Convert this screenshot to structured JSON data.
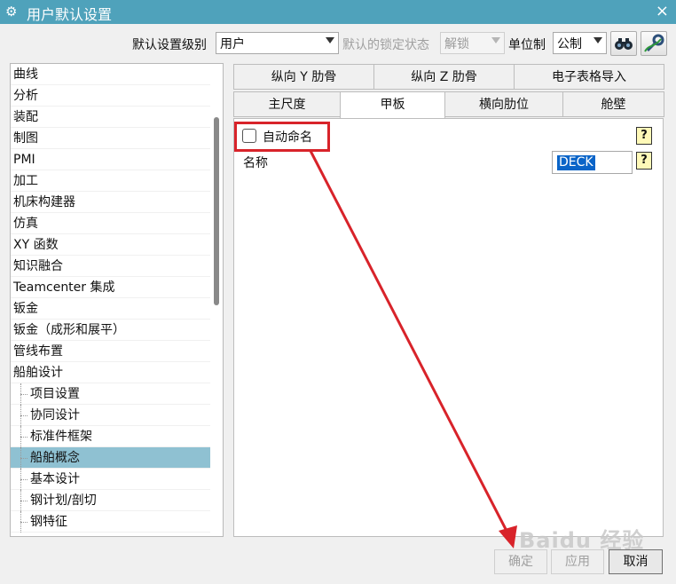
{
  "window": {
    "title": "用户默认设置",
    "close_glyph": "×"
  },
  "topbar": {
    "level_label": "默认设置级别",
    "level_value": "用户",
    "lock_label": "默认的锁定状态",
    "lock_value": "解锁",
    "unit_label": "单位制",
    "unit_value": "公制",
    "find_icon": "binoculars-icon",
    "manage_icon": "wrench-icon"
  },
  "sidebar": {
    "items": [
      "曲线",
      "分析",
      "装配",
      "制图",
      "PMI",
      "加工",
      "机床构建器",
      "仿真",
      "XY 函数",
      "知识融合",
      "Teamcenter 集成",
      "钣金",
      "钣金（成形和展平）",
      "管线布置",
      "船舶设计"
    ],
    "children": [
      "项目设置",
      "协同设计",
      "标准件框架",
      "船舶概念",
      "基本设计",
      "钢计划/剖切",
      "钢特征"
    ],
    "selected": "船舶概念"
  },
  "tabs": {
    "row1": [
      "纵向 Y 肋骨",
      "纵向 Z 肋骨",
      "电子表格导入"
    ],
    "row2": [
      "主尺度",
      "甲板",
      "横向肋位",
      "舱壁"
    ],
    "active": "甲板"
  },
  "panel": {
    "auto_name_label": "自动命名",
    "auto_name_checked": false,
    "name_label": "名称",
    "name_value": "DECK",
    "help_glyph": "?"
  },
  "buttons": {
    "ok": "确定",
    "apply": "应用",
    "cancel": "取消"
  },
  "watermark": "Baidu 经验",
  "colors": {
    "titlebar": "#4fa2bb",
    "selection": "#8fc1d2",
    "annotation": "#d8232a"
  }
}
